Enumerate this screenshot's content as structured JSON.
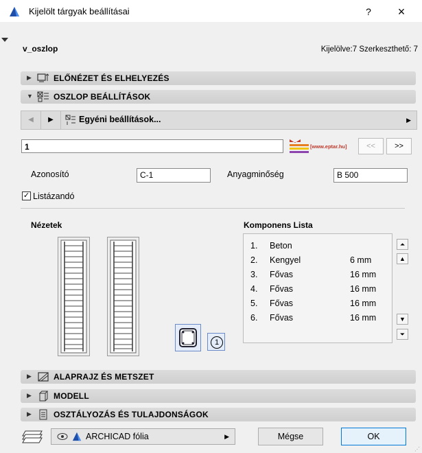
{
  "window": {
    "title": "Kijelölt tárgyak beállításai",
    "help_label": "?",
    "close_label": "×"
  },
  "header": {
    "object_name": "v_oszlop",
    "selection_info": "Kijelölve:7 Szerkeszthető: 7"
  },
  "panels": {
    "preview": {
      "label": "ELŐNÉZET ÉS ELHELYEZÉS",
      "expanded": false
    },
    "column_settings": {
      "label": "OSZLOP BEÁLLÍTÁSOK",
      "expanded": true
    },
    "plan_section": {
      "label": "ALAPRAJZ ÉS METSZET",
      "expanded": false
    },
    "model": {
      "label": "MODELL",
      "expanded": false
    },
    "classification": {
      "label": "OSZTÁLYOZÁS ÉS TULAJDONSÁGOK",
      "expanded": false
    }
  },
  "favorites": {
    "label": "Egyéni beállítások..."
  },
  "column": {
    "name_value": "1",
    "logo_text": "[www.eptar.hu]",
    "prev_label": "<<",
    "next_label": ">>",
    "id_label": "Azonosító",
    "id_value": "C-1",
    "material_label": "Anyagminőség",
    "material_value": "B 500",
    "listable_label": "Listázandó",
    "listable_checked": "✓",
    "views_title": "Nézetek",
    "components_title": "Komponens Lista",
    "components": [
      {
        "num": "1.",
        "name": "Beton",
        "value": ""
      },
      {
        "num": "2.",
        "name": "Kengyel",
        "value": "6 mm"
      },
      {
        "num": "3.",
        "name": "Fővas",
        "value": "16 mm"
      },
      {
        "num": "4.",
        "name": "Fővas",
        "value": "16 mm"
      },
      {
        "num": "5.",
        "name": "Fővas",
        "value": "16 mm"
      },
      {
        "num": "6.",
        "name": "Fővas",
        "value": "16 mm"
      }
    ],
    "section_number": "1"
  },
  "footer": {
    "layer_name": "ARCHICAD fólia",
    "cancel_label": "Mégse",
    "ok_label": "OK"
  },
  "colors": {
    "accent": "#0078d7",
    "panel_header": "#d4d4d4",
    "logo_red": "#c0392b",
    "logo_orange": "#e67e22"
  }
}
